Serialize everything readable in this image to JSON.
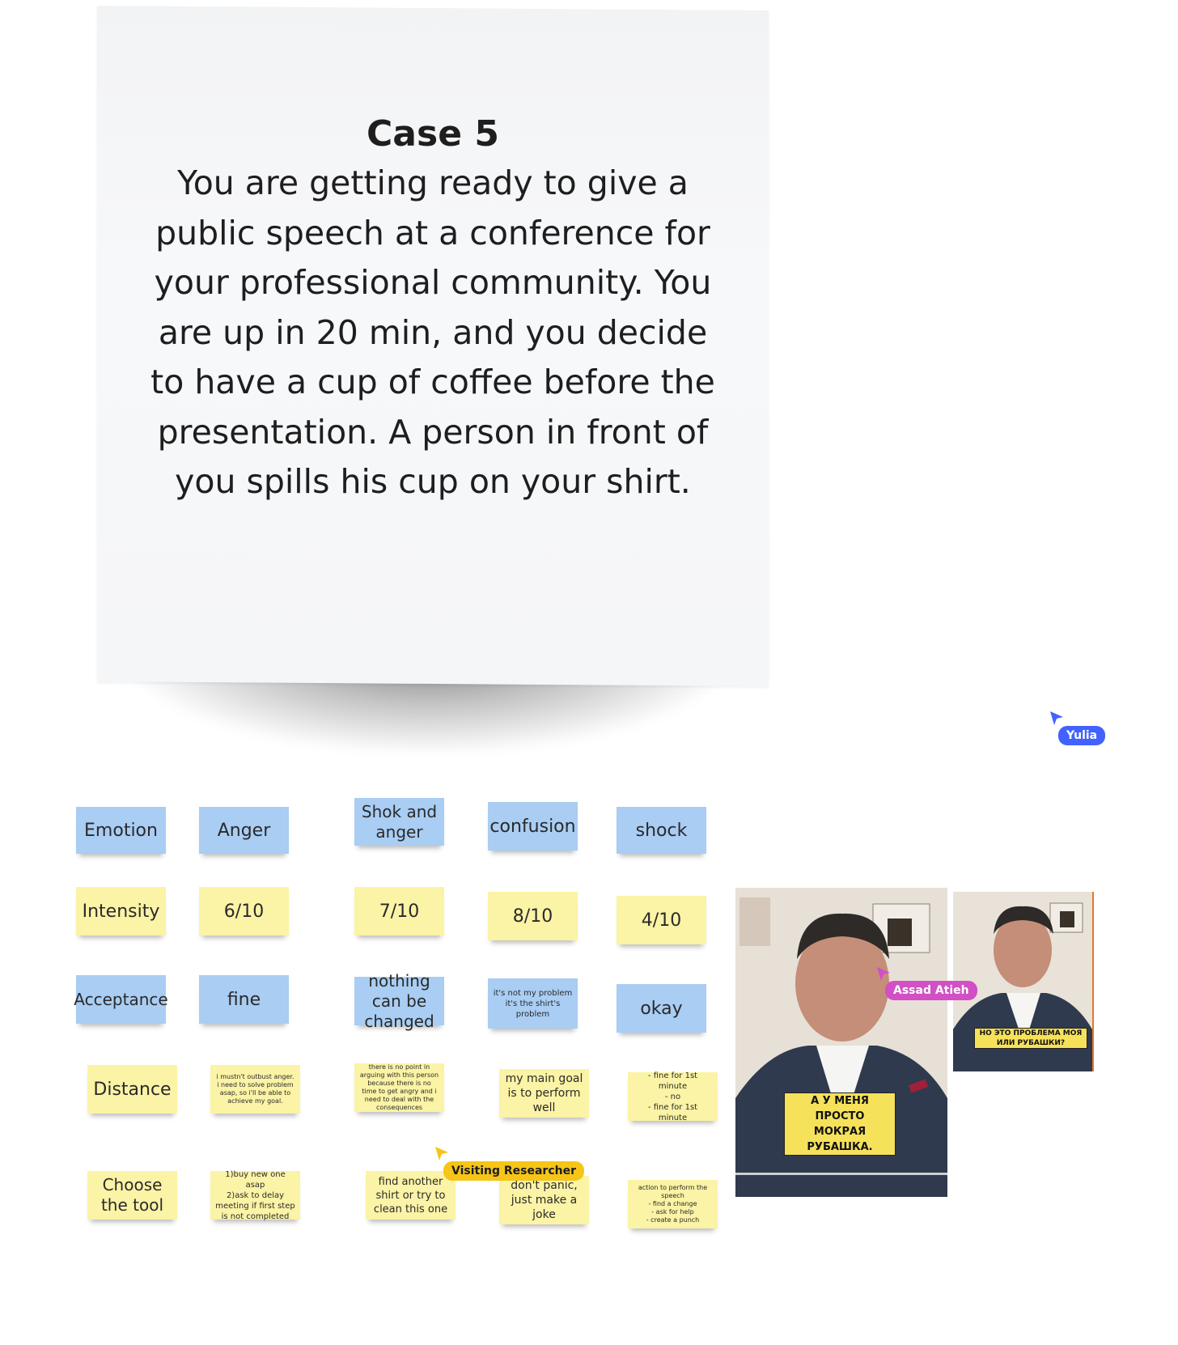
{
  "case_card": {
    "title": "Case 5",
    "body": "You are getting ready to give a public speech at a conference for your professional community. You are up in 20 min, and you decide to have a cup of coffee before the presentation. A person in front of you spills his cup on your shirt."
  },
  "rows": {
    "emotion": [
      "Emotion",
      "Anger",
      "Shok and anger",
      "confusion",
      "shock"
    ],
    "intensity": [
      "Intensity",
      "6/10",
      "7/10",
      "8/10",
      "4/10"
    ],
    "acceptance": [
      "Acceptance",
      "fine",
      "nothing can be changed",
      "it's not my problem\nit's the shirt's\nproblem",
      "okay"
    ],
    "distance": [
      "Distance",
      "i mustn't outbust anger. i need to solve problem asap, so i'll be able to achieve my goal.",
      "there is no point in arguing with this person because there is no time to get angry and i need to deal with the consequences",
      "my main goal is to perform well",
      "- fine for 1st minute\n- no\n- fine for 1st minute"
    ],
    "tool": [
      "Choose the tool",
      "1)buy new one asap\n2)ask to delay meeting if first step is not completed",
      "find another shirt or try to clean this one",
      "don't panic, just make a joke",
      "action to perform the speech\n- find a change\n- ask for help\n- create a punch"
    ]
  },
  "videos": {
    "main_caption": "А У МЕНЯ ПРОСТО\nМОКРАЯ РУБАШКА.",
    "side_caption": "НО ЭТО ПРОБЛЕМА МОЯ\nИЛИ РУБАШКИ?"
  },
  "cursors": {
    "yulia": {
      "name": "Yulia",
      "color": "#4262ff"
    },
    "assad": {
      "name": "Assad Atieh",
      "color": "#d24fc5"
    },
    "visitor": {
      "name": "Visiting Researcher",
      "color": "#f5c518"
    }
  }
}
